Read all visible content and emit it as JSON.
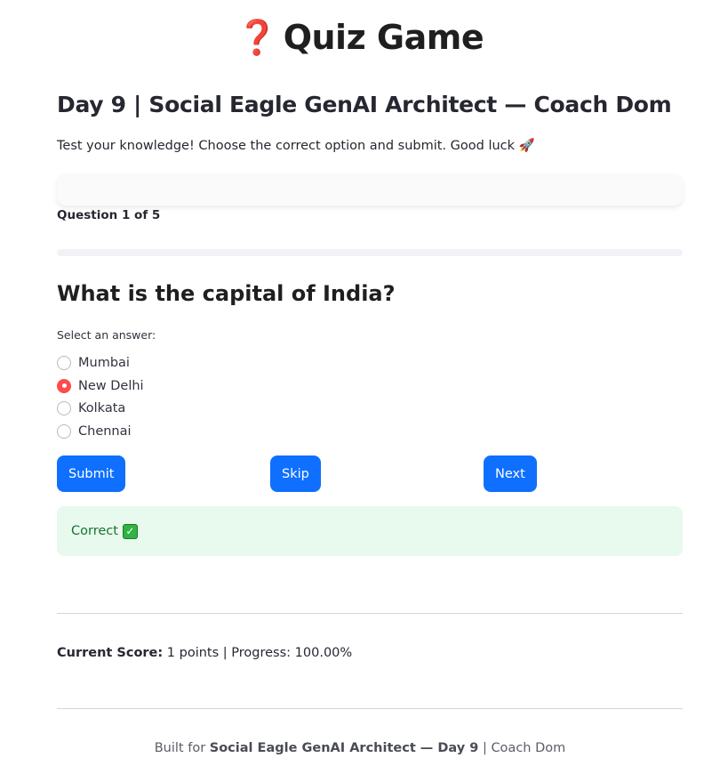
{
  "header": {
    "icon": "question-mark-icon",
    "icon_glyph": "❓",
    "title": "Quiz Game",
    "subtitle": "Day 9 | Social Eagle GenAI Architect — Coach Dom",
    "intro": "Test your knowledge! Choose the correct option and submit. Good luck 🚀"
  },
  "quiz": {
    "counter": "Question 1 of 5",
    "question": "What is the capital of India?",
    "answer_prompt": "Select an answer:",
    "options": [
      {
        "label": "Mumbai",
        "selected": false
      },
      {
        "label": "New Delhi",
        "selected": true
      },
      {
        "label": "Kolkata",
        "selected": false
      },
      {
        "label": "Chennai",
        "selected": false
      }
    ]
  },
  "buttons": {
    "submit": "Submit",
    "skip": "Skip",
    "next": "Next"
  },
  "feedback": {
    "text": "Correct",
    "icon": "check-mark-icon",
    "icon_glyph": "✓"
  },
  "score": {
    "label": "Current Score:",
    "value": "1 points",
    "separator": "|",
    "progress_text": "Progress: 100.00%"
  },
  "footer": {
    "prefix": "Built for",
    "bold_text": "Social Eagle GenAI Architect — Day 9",
    "separator": "|",
    "suffix": "Coach Dom"
  },
  "colors": {
    "button_bg": "#0f6fff",
    "radio_selected": "#ff4b4b",
    "success_bg": "#e8f9ee",
    "success_text": "#177233",
    "title_icon": "#d8331c"
  }
}
